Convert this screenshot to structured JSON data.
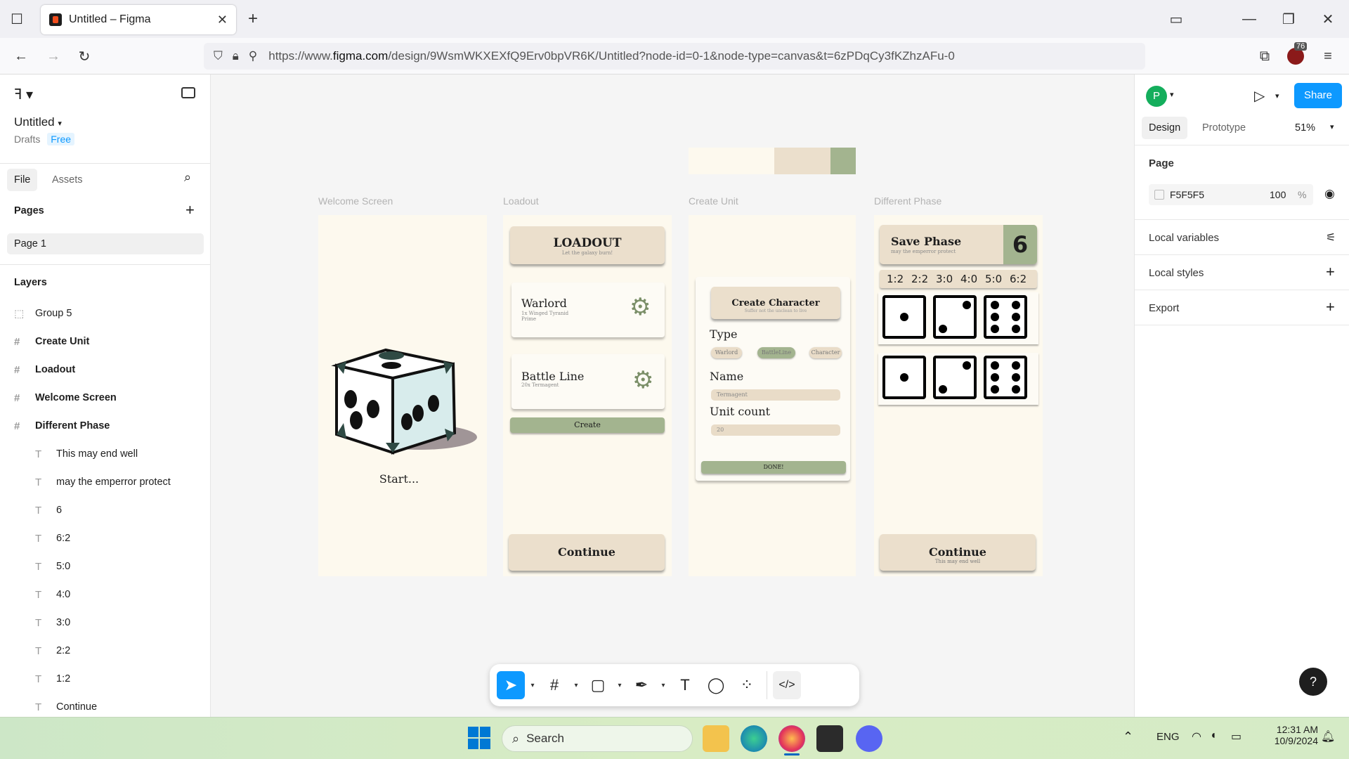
{
  "browser": {
    "tab_title": "Untitled – Figma",
    "url_prefix": "https://www.",
    "url_host": "figma.com",
    "url_path": "/design/9WsmWKXEXfQ9Erv0bpVR6K/Untitled?node-id=0-1&node-type=canvas&t=6zPDqCy3fKZhzAFu-0",
    "extension_badge": "76"
  },
  "left_panel": {
    "file_name": "Untitled",
    "location": "Drafts",
    "plan": "Free",
    "tabs": [
      "File",
      "Assets"
    ],
    "pages_heading": "Pages",
    "pages": [
      "Page 1"
    ],
    "layers_heading": "Layers",
    "layers": [
      {
        "name": "Group 5",
        "kind": "group"
      },
      {
        "name": "Create Unit",
        "kind": "frame"
      },
      {
        "name": "Loadout",
        "kind": "frame"
      },
      {
        "name": "Welcome Screen",
        "kind": "frame"
      },
      {
        "name": "Different Phase",
        "kind": "frame"
      },
      {
        "name": "This may end well",
        "kind": "text"
      },
      {
        "name": "may the emperror protect",
        "kind": "text"
      },
      {
        "name": "6",
        "kind": "text"
      },
      {
        "name": "6:2",
        "kind": "text"
      },
      {
        "name": "5:0",
        "kind": "text"
      },
      {
        "name": "4:0",
        "kind": "text"
      },
      {
        "name": "3:0",
        "kind": "text"
      },
      {
        "name": "2:2",
        "kind": "text"
      },
      {
        "name": "1:2",
        "kind": "text"
      },
      {
        "name": "Continue",
        "kind": "text"
      }
    ]
  },
  "canvas": {
    "palette": [
      "#fdf9ee",
      "#ebdfcc",
      "#a3b48f"
    ],
    "welcome": {
      "label": "Welcome Screen",
      "start": "Start..."
    },
    "loadout": {
      "label": "Loadout",
      "title": "LOADOUT",
      "subtitle": "Let the galaxy burn!",
      "card1_title": "Warlord",
      "card1_sub": "1x Winged Tyranid Prime",
      "card2_title": "Battle Line",
      "card2_sub": "20x Termagent",
      "create": "Create",
      "continue": "Continue"
    },
    "create_unit": {
      "label": "Create Unit",
      "title": "Create Character",
      "subtitle": "Suffer not the unclean to live",
      "type_label": "Type",
      "types": [
        "Warlord",
        "BattleLine",
        "Character"
      ],
      "name_label": "Name",
      "name_value": "Termagent",
      "count_label": "Unit count",
      "count_value": "20",
      "done": "DONE!"
    },
    "different_phase": {
      "label": "Different Phase",
      "title": "Save Phase",
      "subtitle": "may the emperror protect",
      "number": "6",
      "ratios": [
        "1:2",
        "2:2",
        "3:0",
        "4:0",
        "5:0",
        "6:2"
      ],
      "continue": "Continue",
      "continue_sub": "This may end well"
    }
  },
  "right_panel": {
    "user_initial": "P",
    "share": "Share",
    "tabs": [
      "Design",
      "Prototype"
    ],
    "zoom": "51%",
    "page_heading": "Page",
    "page_color": "F5F5F5",
    "page_opacity": "100",
    "percent": "%",
    "sections": [
      "Local variables",
      "Local styles",
      "Export"
    ],
    "help": "?"
  },
  "taskbar": {
    "search": "Search",
    "lang": "ENG",
    "time": "12:31 AM",
    "date": "10/9/2024"
  }
}
